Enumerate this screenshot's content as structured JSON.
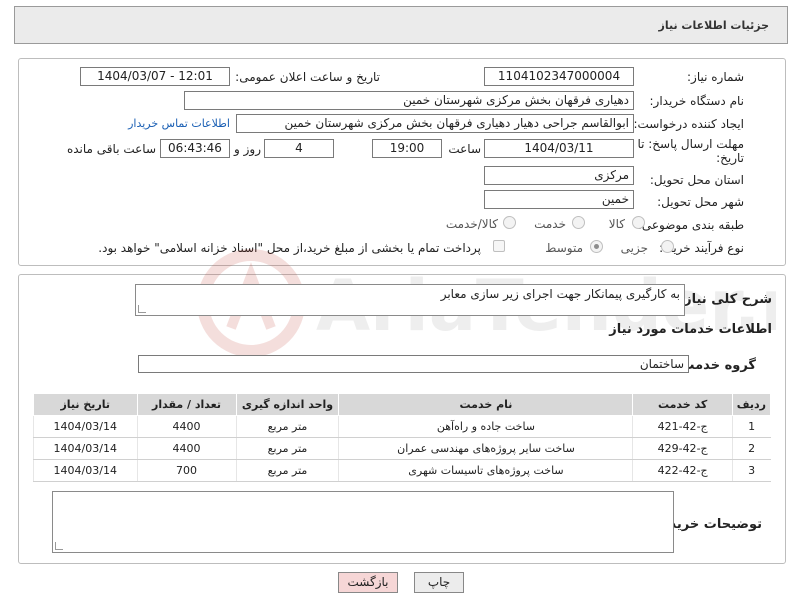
{
  "header": {
    "title": "جزئیات اطلاعات نیاز"
  },
  "form": {
    "need_number_label": "شماره نیاز:",
    "need_number": "1104102347000004",
    "announce_label": "تاریخ و ساعت اعلان عمومی:",
    "announce_value": "1404/03/07 - 12:01",
    "buyer_org_label": "نام دستگاه خریدار:",
    "buyer_org": "دهیاری فرقهان بخش مرکزی شهرستان خمین",
    "creator_label": "ایجاد کننده درخواست:",
    "creator": "ابوالقاسم جراحی دهیار  دهیاری فرقهان بخش مرکزی شهرستان خمین",
    "contact_link": "اطلاعات تماس خریدار",
    "deadline_label_line1": "مهلت ارسال پاسخ: تا",
    "deadline_label_line2": "تاریخ:",
    "deadline_date": "1404/03/11",
    "time_label": "ساعت",
    "deadline_time": "19:00",
    "days_value": "4",
    "days_label": "روز و",
    "remaining_time": "06:43:46",
    "remaining_label": "ساعت باقی مانده",
    "province_label": "استان محل تحویل:",
    "province": "مرکزی",
    "city_label": "شهر محل تحویل:",
    "city": "خمین",
    "category_label": "طبقه بندی موضوعی:",
    "category_options": [
      "کالا",
      "خدمت",
      "کالا/خدمت"
    ],
    "process_label": "نوع فرآیند خرید :",
    "process_options": [
      "جزیی",
      "متوسط"
    ],
    "payment_note": "پرداخت تمام یا بخشی از مبلغ خرید،از محل \"اسناد خزانه اسلامی\" خواهد بود."
  },
  "summary": {
    "label": "شرح کلی نیاز:",
    "text": "به کارگیری پیمانکار جهت اجرای زیر سازی معابر"
  },
  "services": {
    "section_title": "اطلاعات خدمات مورد نیاز",
    "group_label": "گروه خدمت:",
    "group_value": "ساختمان",
    "columns": [
      "ردیف",
      "کد خدمت",
      "نام خدمت",
      "واحد اندازه گیری",
      "تعداد / مقدار",
      "تاریخ نیاز"
    ],
    "rows": [
      [
        "1",
        "ج-42-421",
        "ساخت جاده و راه‌آهن",
        "متر مربع",
        "4400",
        "1404/03/14"
      ],
      [
        "2",
        "ج-42-429",
        "ساخت سایر پروژه‌های مهندسی عمران",
        "متر مربع",
        "4400",
        "1404/03/14"
      ],
      [
        "3",
        "ج-42-422",
        "ساخت پروژه‌های تاسیسات شهری",
        "متر مربع",
        "700",
        "1404/03/14"
      ]
    ]
  },
  "buyer_notes": {
    "label": "توضیحات خریدار:",
    "text": ""
  },
  "buttons": {
    "print": "چاپ",
    "back": "بازگشت"
  },
  "colors": {
    "back_button_bg": "#f6d6d6",
    "print_button_bg": "#ececec",
    "table_header_bg": "#d8d8d8",
    "link": "#1a5fb4"
  }
}
